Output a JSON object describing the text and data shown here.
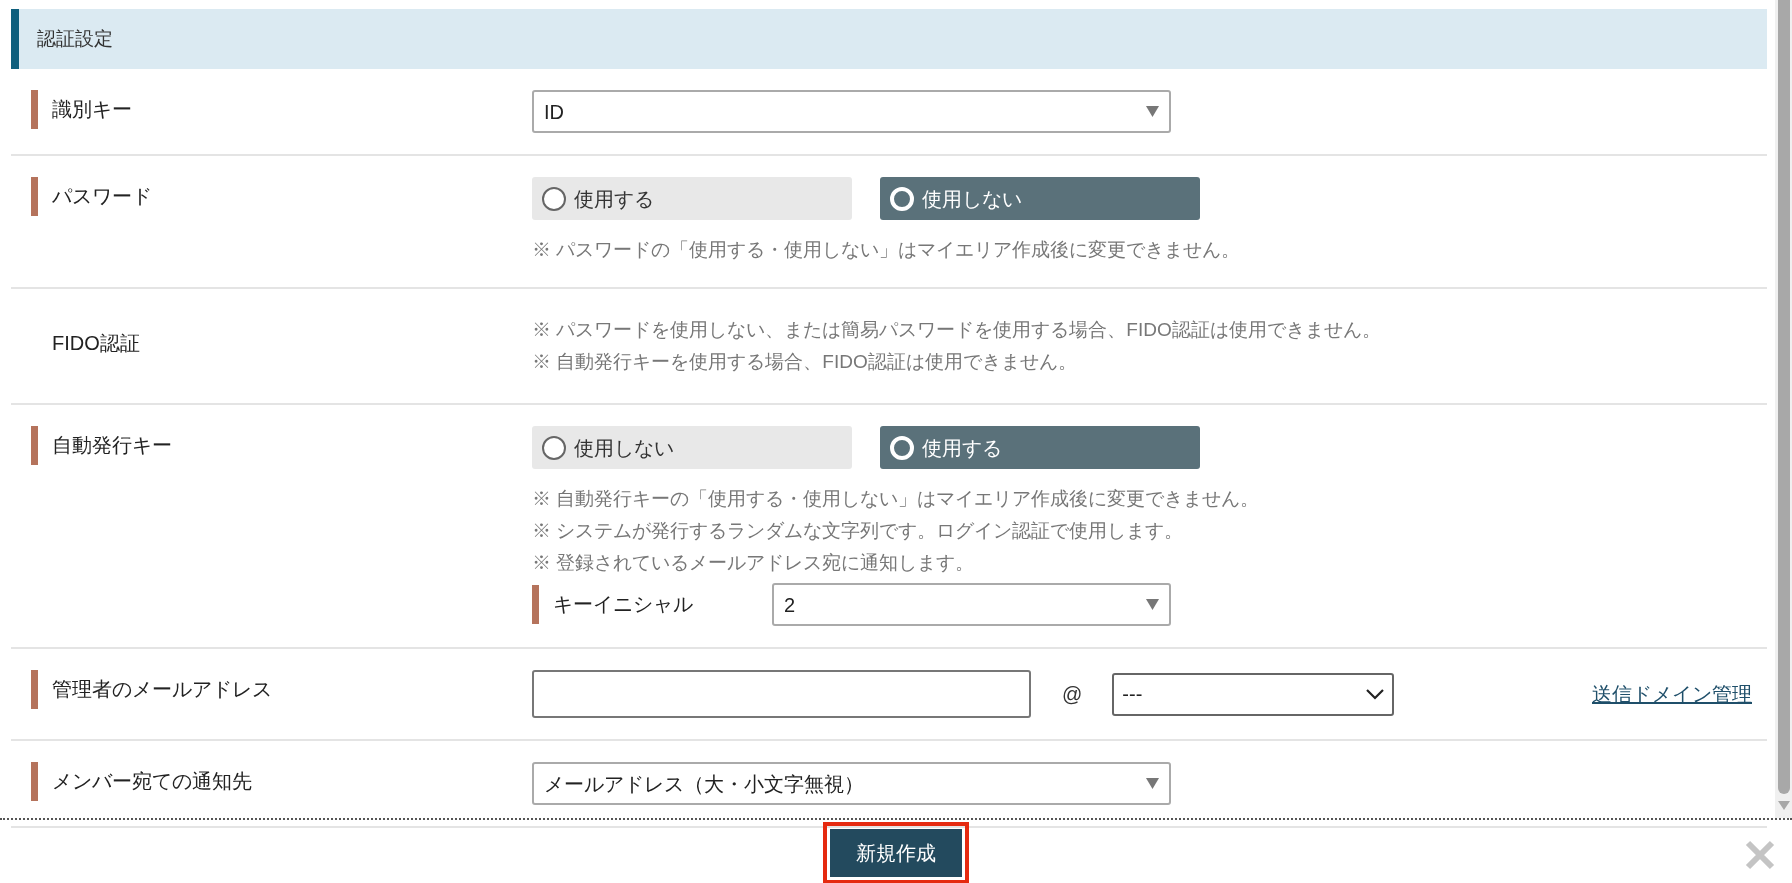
{
  "section": {
    "title": "認証設定"
  },
  "rows": [
    {
      "kind": "select",
      "label": "識別キー",
      "required": true,
      "value": "ID"
    },
    {
      "kind": "radio",
      "label": "パスワード",
      "required": true,
      "options": [
        {
          "label": "使用する",
          "selected": false
        },
        {
          "label": "使用しない",
          "selected": true
        }
      ],
      "notes": [
        "※ パスワードの「使用する・使用しない」はマイエリア作成後に変更できません。"
      ]
    },
    {
      "kind": "notes",
      "label": "FIDO認証",
      "required": false,
      "notes": [
        "※ パスワードを使用しない、または簡易パスワードを使用する場合、FIDO認証は使用できません。",
        "※ 自動発行キーを使用する場合、FIDO認証は使用できません。"
      ]
    },
    {
      "kind": "radio",
      "label": "自動発行キー",
      "required": true,
      "options": [
        {
          "label": "使用しない",
          "selected": false
        },
        {
          "label": "使用する",
          "selected": true
        }
      ],
      "notes": [
        "※ 自動発行キーの「使用する・使用しない」はマイエリア作成後に変更できません。",
        "※ システムが発行するランダムな文字列です。ログイン認証で使用します。",
        "※ 登録されているメールアドレス宛に通知します。"
      ],
      "sub": {
        "label": "キーイニシャル",
        "value": "2"
      }
    },
    {
      "kind": "email",
      "label": "管理者のメールアドレス",
      "required": true,
      "at": "@",
      "domain": "---",
      "link": "送信ドメイン管理"
    },
    {
      "kind": "select",
      "label": "メンバー宛ての通知先",
      "required": true,
      "value": "メールアドレス（大・小文字無視）"
    }
  ],
  "footer": {
    "button": "新規作成"
  }
}
